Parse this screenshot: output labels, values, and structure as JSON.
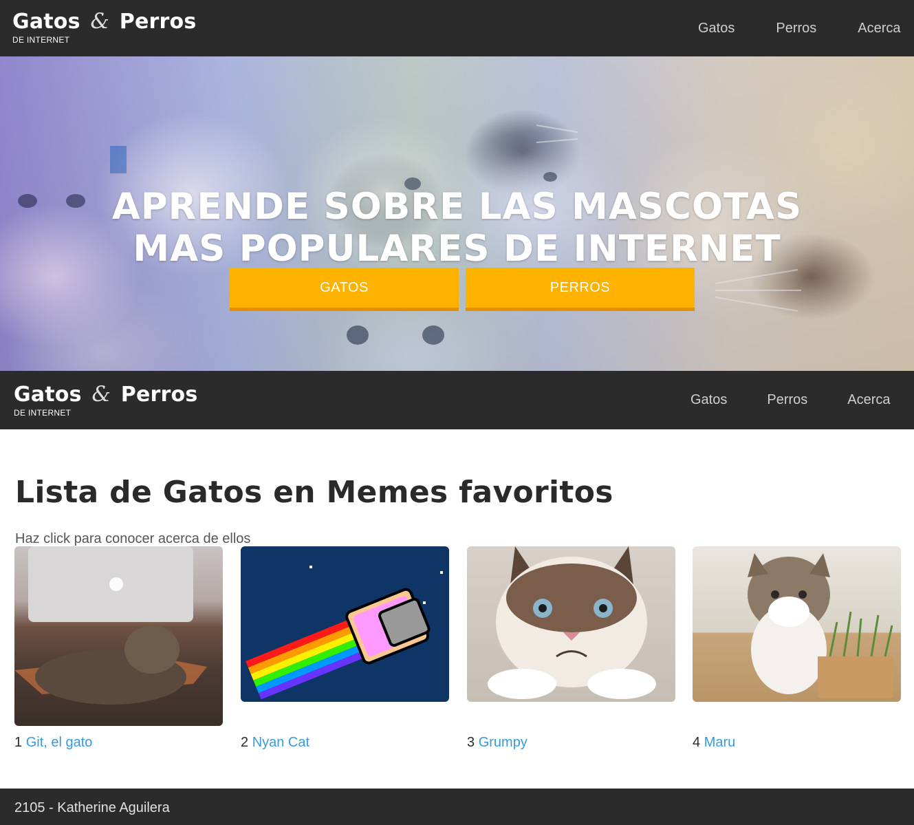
{
  "brand": {
    "name_part1": "Gatos",
    "amp": "&",
    "name_part2": "Perros",
    "subtitle": "DE INTERNET"
  },
  "nav": {
    "items": [
      {
        "label": "Gatos"
      },
      {
        "label": "Perros"
      },
      {
        "label": "Acerca"
      }
    ]
  },
  "hero": {
    "title_line1": "APRENDE SOBRE LAS MASCOTAS",
    "title_line2": "MAS POPULARES DE INTERNET",
    "button_gatos": "GATOS",
    "button_perros": "PERROS"
  },
  "main": {
    "title": "Lista de Gatos en Memes favoritos",
    "subtitle": "Haz click para conocer acerca de ellos",
    "cats": [
      {
        "number": "1",
        "name": "Git, el gato"
      },
      {
        "number": "2",
        "name": "Nyan Cat"
      },
      {
        "number": "3",
        "name": "Grumpy"
      },
      {
        "number": "4",
        "name": "Maru"
      }
    ]
  },
  "footer": {
    "text": "2105 - Katherine Aguilera"
  },
  "colors": {
    "navbar_bg": "#2b2b2b",
    "button_bg": "#fdb200",
    "button_border": "#e48f00",
    "link": "#3a9ad9"
  }
}
